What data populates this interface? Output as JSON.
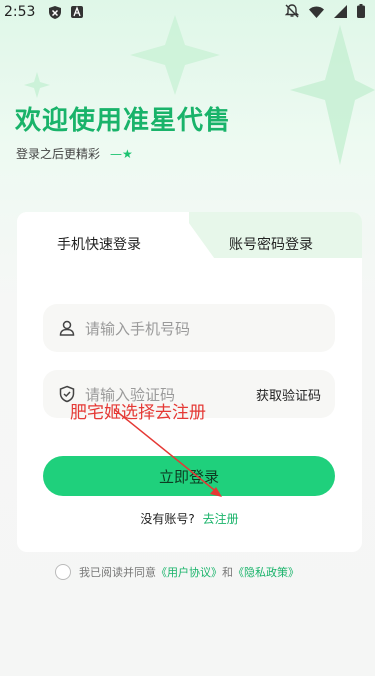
{
  "status_bar": {
    "time": "2:53",
    "left_icons": [
      "shield-icon",
      "a-icon"
    ],
    "right_icons": [
      "bell-off-icon",
      "wifi-icon",
      "signal-icon",
      "battery-icon"
    ]
  },
  "header": {
    "welcome": "欢迎使用准星代售",
    "subtitle": "登录之后更精彩",
    "subtitle_arrow": "—★"
  },
  "tabs": {
    "quick_login": "手机快速登录",
    "password_login": "账号密码登录",
    "active": "quick_login"
  },
  "form": {
    "phone_placeholder": "请输入手机号码",
    "code_placeholder": "请输入验证码",
    "get_code": "获取验证码",
    "login_button": "立即登录",
    "no_account": "没有账号?",
    "register_link": "去注册"
  },
  "agreement": {
    "prefix": "我已阅读并同意",
    "user_agreement": "《用户协议》",
    "and": "和",
    "privacy_policy": "《隐私政策》"
  },
  "annotation": {
    "text": "肥宅姬选择去注册",
    "color": "#e53935"
  },
  "colors": {
    "brand_green": "#19b36a",
    "button_green": "#1fd07c"
  }
}
